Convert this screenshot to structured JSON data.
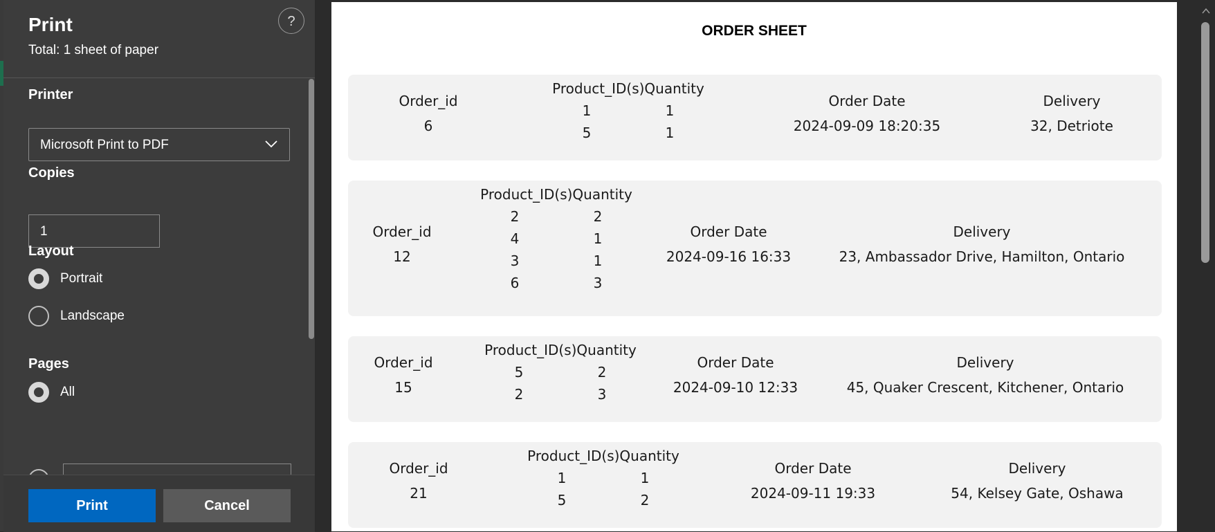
{
  "dialog": {
    "title": "Print",
    "subtitle": "Total: 1 sheet of paper",
    "help_label": "?",
    "printer_label": "Printer",
    "printer_value": "Microsoft Print to PDF",
    "copies_label": "Copies",
    "copies_value": "1",
    "layout_label": "Layout",
    "layout_options": [
      {
        "label": "Portrait",
        "checked": true
      },
      {
        "label": "Landscape",
        "checked": false
      }
    ],
    "pages_label": "Pages",
    "pages_options": [
      {
        "label": "All",
        "checked": true
      }
    ],
    "print_button": "Print",
    "cancel_button": "Cancel"
  },
  "preview": {
    "title": "ORDER SHEET",
    "headers": {
      "order_id": "Order_id",
      "products": "Product_ID(s)Quantity",
      "order_date": "Order Date",
      "delivery": "Delivery"
    },
    "orders": [
      {
        "order_id": "6",
        "products": [
          [
            "1",
            "1"
          ],
          [
            "5",
            "1"
          ]
        ],
        "order_date": "2024-09-09 18:20:35",
        "delivery": "32, Detriote"
      },
      {
        "order_id": "12",
        "products": [
          [
            "2",
            "2"
          ],
          [
            "4",
            "1"
          ],
          [
            "3",
            "1"
          ],
          [
            "6",
            "3"
          ]
        ],
        "order_date": "2024-09-16 16:33",
        "delivery": "23, Ambassador Drive, Hamilton, Ontario"
      },
      {
        "order_id": "15",
        "products": [
          [
            "5",
            "2"
          ],
          [
            "2",
            "3"
          ]
        ],
        "order_date": "2024-09-10 12:33",
        "delivery": "45, Quaker Crescent, Kitchener, Ontario"
      },
      {
        "order_id": "21",
        "products": [
          [
            "1",
            "1"
          ],
          [
            "5",
            "2"
          ]
        ],
        "order_date": "2024-09-11 19:33",
        "delivery": "54, Kelsey Gate, Oshawa"
      }
    ]
  }
}
